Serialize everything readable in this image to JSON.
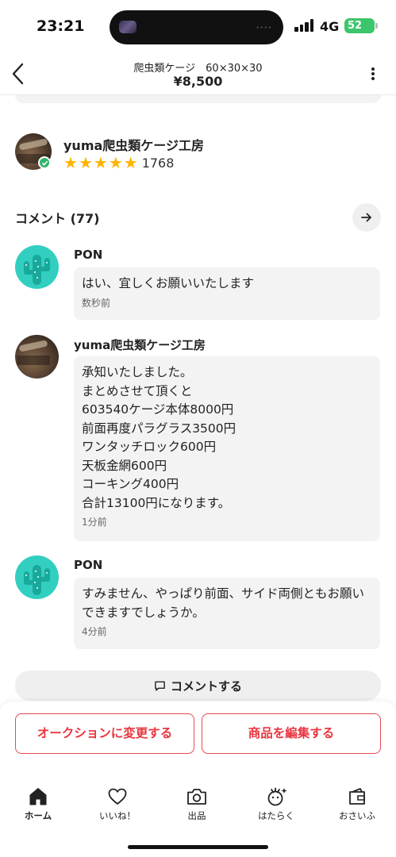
{
  "status_bar": {
    "time": "23:21",
    "network": "4G",
    "battery": "52"
  },
  "header": {
    "title": "爬虫類ケージ　60×30×30",
    "price": "¥8,500"
  },
  "seller": {
    "name": "yuma爬虫類ケージ工房",
    "rating_count": "1768",
    "stars": 5
  },
  "comments_section": {
    "title": "コメント (77)"
  },
  "comments": [
    {
      "author": "PON",
      "avatar": "cactus-avatar",
      "text": "はい、宜しくお願いいたします",
      "time": "数秒前"
    },
    {
      "author": "yuma爬虫類ケージ工房",
      "avatar": "photo-avatar",
      "text": "承知いたしました。\nまとめさせて頂くと\n603540ケージ本体8000円\n前面再度パラグラス3500円\nワンタッチロック600円\n天板金網600円\nコーキング400円\n合計13100円になります。",
      "time": "1分前"
    },
    {
      "author": "PON",
      "avatar": "cactus-avatar",
      "text": "すみません、やっぱり前面、サイド両側ともお願いできますでしょうか。",
      "time": "4分前"
    }
  ],
  "comment_button": {
    "label": "コメントする"
  },
  "actions": {
    "left_label": "オークションに変更する",
    "right_label": "商品を編集する",
    "accent_color": "#e8363f"
  },
  "tabs": [
    {
      "label": "ホーム",
      "icon": "home-icon",
      "active": true
    },
    {
      "label": "いいね！",
      "icon": "heart-icon",
      "active": false
    },
    {
      "label": "出品",
      "icon": "camera-icon",
      "active": false
    },
    {
      "label": "はたらく",
      "icon": "work-icon",
      "active": false
    },
    {
      "label": "おさいふ",
      "icon": "wallet-icon",
      "active": false
    }
  ]
}
